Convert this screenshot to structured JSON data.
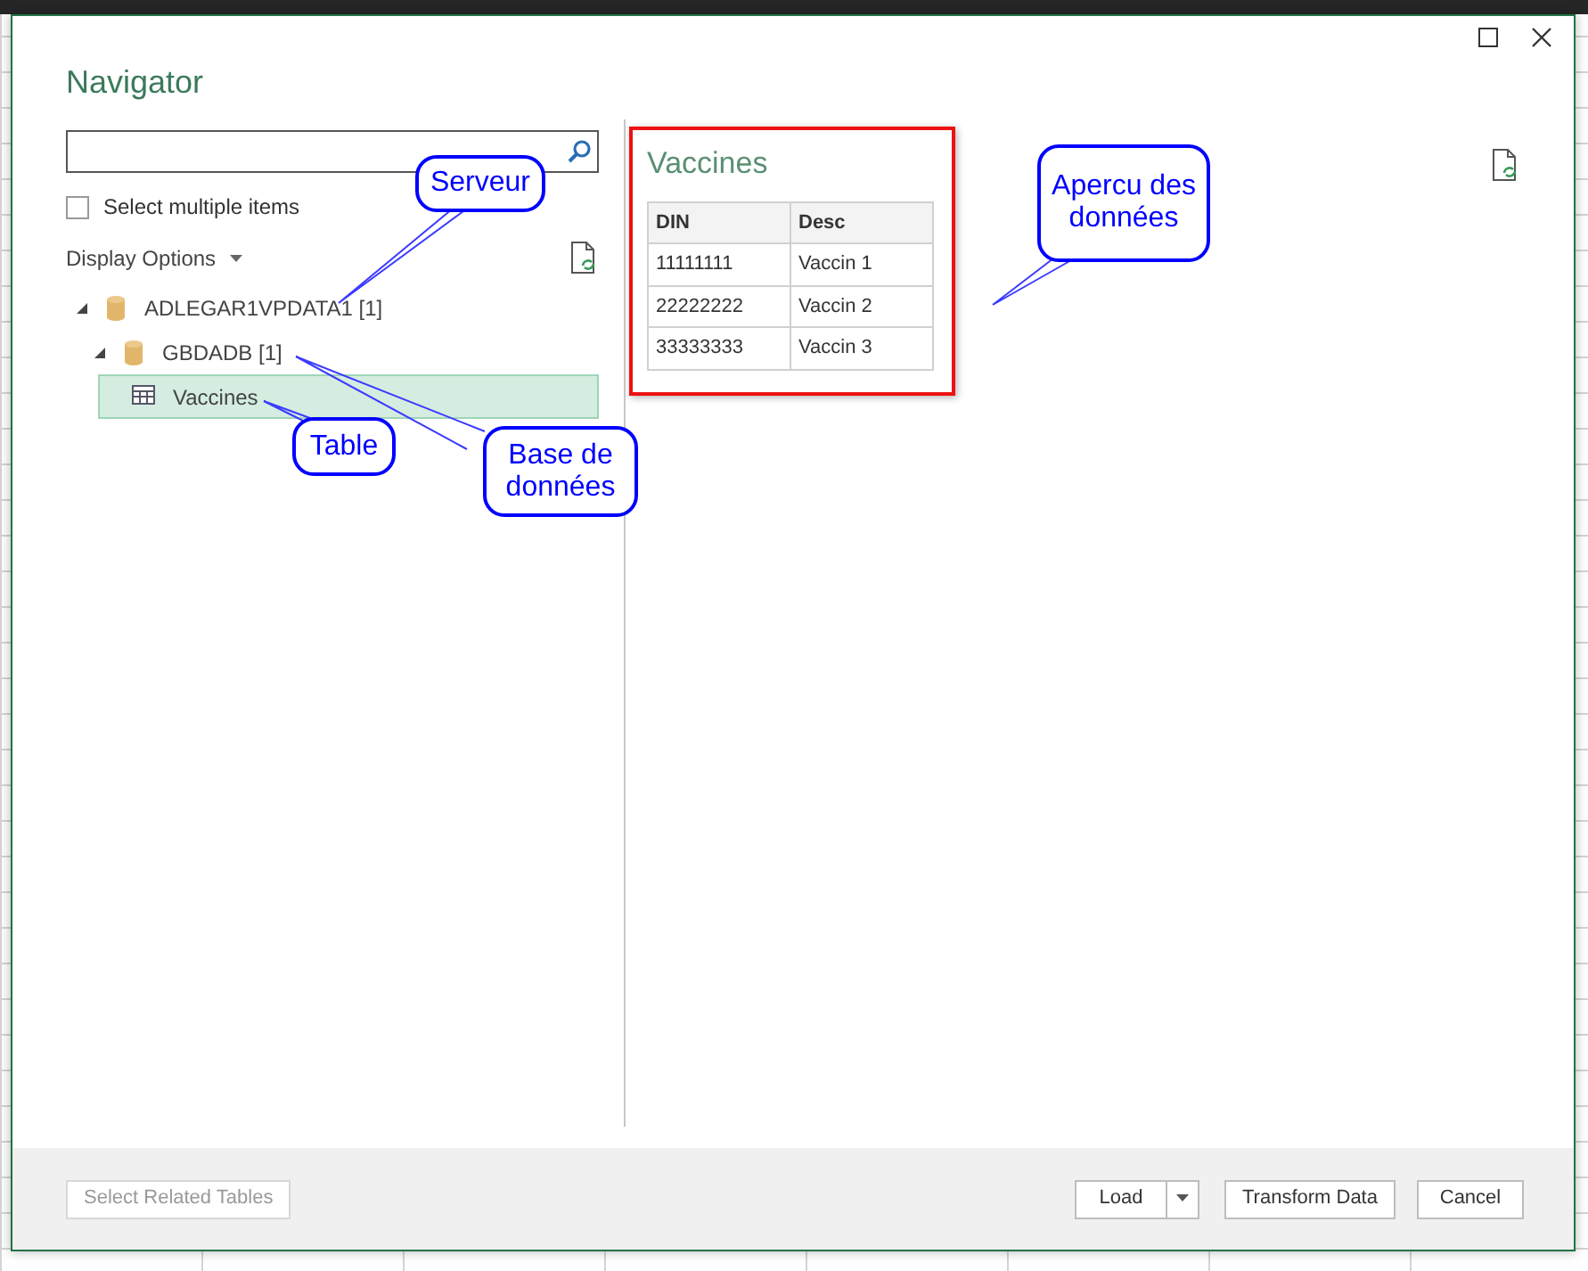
{
  "window": {
    "title": "Navigator"
  },
  "select_multiple": {
    "label": "Select multiple items",
    "checked": false
  },
  "display_options": {
    "label": "Display Options"
  },
  "tree": [
    {
      "label": "ADLEGAR1VPDATA1 [1]",
      "kind": "server",
      "expanded": true,
      "selected": false,
      "children": [
        {
          "label": "GBDADB [1]",
          "kind": "database",
          "expanded": true,
          "selected": false,
          "children": [
            {
              "label": "Vaccines",
              "kind": "table",
              "selected": true
            }
          ]
        }
      ]
    }
  ],
  "preview": {
    "title": "Vaccines",
    "columns": [
      "DIN",
      "Desc"
    ],
    "rows": [
      [
        "11111111",
        "Vaccin 1"
      ],
      [
        "22222222",
        "Vaccin 2"
      ],
      [
        "33333333",
        "Vaccin 3"
      ]
    ]
  },
  "footer": {
    "left_button": {
      "label": "Select Related Tables",
      "disabled": true
    },
    "buttons": [
      {
        "label": "Load",
        "kind": "split"
      },
      {
        "label": "Transform Data",
        "kind": "plain"
      },
      {
        "label": "Cancel",
        "kind": "plain"
      }
    ]
  },
  "callouts": [
    {
      "text": "Serveur"
    },
    {
      "text": "Table"
    },
    {
      "text": "Base de données"
    },
    {
      "text": "Apercu des données"
    }
  ]
}
